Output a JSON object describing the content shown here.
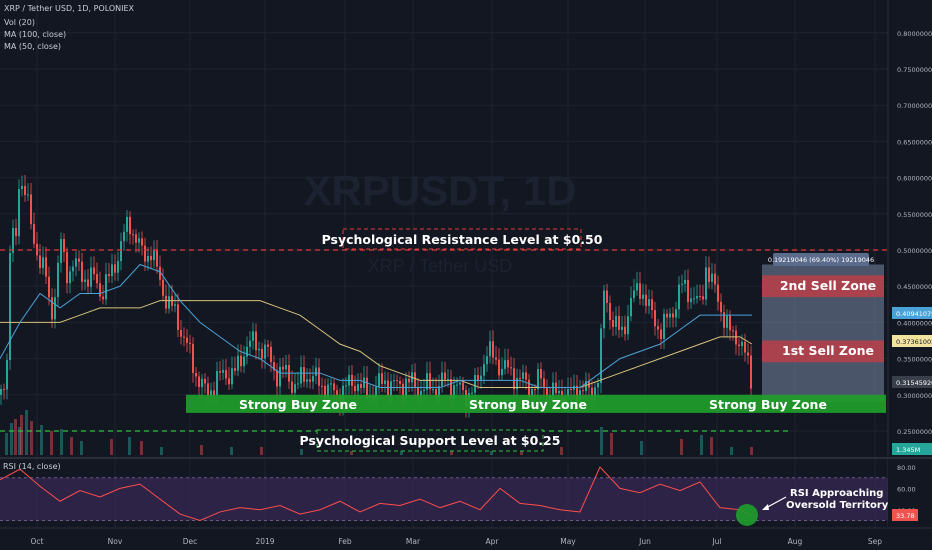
{
  "header": {
    "symbol_line": "XRP / Tether USD, 1D, POLONIEX",
    "indicator_1": "Vol (20)",
    "indicator_2": "MA (100, close)",
    "indicator_3": "MA (50, close)",
    "rsi_label": "RSI (14, close)"
  },
  "colors": {
    "background": "#131722",
    "bull": "#26a69a",
    "bear": "#ef5350",
    "ma50": "#4aa3d8",
    "ma100": "#d6c27a",
    "rsi_line": "#ff4d4d",
    "rsi_band": "#3b2a5a",
    "buy_zone": "#1e9e2a",
    "sell_zone": "#b5404a",
    "measure_box": "#7888a6"
  },
  "chart_data": [
    {
      "type": "candlestick",
      "watermark_symbol": "XRPUSDT, 1D",
      "watermark_name": "XRP / Tether USD",
      "x_tick_labels": [
        "Oct",
        "Nov",
        "Dec",
        "2019",
        "Feb",
        "Mar",
        "Apr",
        "May",
        "Jun",
        "Jul",
        "Aug",
        "Sep"
      ],
      "y_tick_labels": [
        "0.80000000",
        "0.75000000",
        "0.70000000",
        "0.65000000",
        "0.60000000",
        "0.55000000",
        "0.50000000",
        "0.45000000",
        "0.40000000",
        "0.35000000",
        "0.30000000",
        "0.25000000"
      ],
      "ylim": [
        0.2,
        0.83
      ],
      "price_labels": {
        "ma50_value": "0.40941079",
        "ma100_value": "0.37361003",
        "last_price": "0.31545920",
        "volume": "1.345M"
      },
      "measure_label": "0.19219046 (69.40%) 19219046",
      "annotations": {
        "resistance": "Psychological Resistance Level at $0.50",
        "support": "Psychological Support Level at $0.25",
        "buy_zone": "Strong Buy Zone",
        "sell_zone_1": "1st Sell Zone",
        "sell_zone_2": "2nd Sell Zone"
      },
      "levels": {
        "resistance": 0.5,
        "support": 0.25,
        "buy_zone": [
          0.275,
          0.3
        ],
        "sell_zone_1": [
          0.345,
          0.375
        ],
        "sell_zone_2": [
          0.435,
          0.465
        ],
        "measure_box": [
          0.29,
          0.48
        ]
      },
      "price_path": {
        "x": [
          0,
          7,
          10,
          14,
          18,
          25,
          30,
          38,
          45,
          50,
          56,
          60,
          65,
          73,
          80,
          86,
          95,
          100,
          108,
          116,
          128,
          134,
          142,
          150,
          158,
          166,
          175,
          185,
          195,
          205,
          215,
          225,
          235,
          245,
          255,
          265,
          275,
          285,
          295,
          305,
          315,
          325,
          335,
          345,
          355,
          365,
          375,
          385,
          395,
          405,
          415,
          425,
          435,
          445,
          455,
          465,
          475,
          485,
          493,
          500,
          510,
          520,
          530,
          540,
          550,
          560,
          570,
          580,
          590,
          598,
          603,
          610,
          620,
          630,
          640,
          650,
          660,
          670,
          680,
          690,
          700,
          705,
          712,
          720,
          730,
          738,
          745,
          752
        ],
        "close": [
          0.3,
          0.36,
          0.56,
          0.48,
          0.6,
          0.58,
          0.53,
          0.49,
          0.46,
          0.41,
          0.46,
          0.51,
          0.47,
          0.48,
          0.47,
          0.46,
          0.46,
          0.44,
          0.46,
          0.49,
          0.54,
          0.52,
          0.49,
          0.5,
          0.46,
          0.43,
          0.41,
          0.37,
          0.33,
          0.3,
          0.32,
          0.33,
          0.33,
          0.37,
          0.37,
          0.36,
          0.33,
          0.33,
          0.31,
          0.33,
          0.32,
          0.31,
          0.3,
          0.31,
          0.32,
          0.3,
          0.31,
          0.32,
          0.31,
          0.32,
          0.31,
          0.31,
          0.31,
          0.32,
          0.31,
          0.3,
          0.31,
          0.36,
          0.35,
          0.34,
          0.33,
          0.32,
          0.31,
          0.32,
          0.3,
          0.3,
          0.3,
          0.31,
          0.3,
          0.33,
          0.44,
          0.41,
          0.38,
          0.43,
          0.45,
          0.41,
          0.39,
          0.41,
          0.45,
          0.44,
          0.42,
          0.48,
          0.45,
          0.42,
          0.38,
          0.38,
          0.35,
          0.31
        ]
      },
      "ma50": {
        "x": [
          0,
          20,
          40,
          60,
          80,
          100,
          120,
          140,
          160,
          180,
          200,
          220,
          240,
          260,
          280,
          300,
          320,
          340,
          360,
          380,
          400,
          420,
          440,
          460,
          480,
          500,
          520,
          540,
          560,
          580,
          600,
          620,
          640,
          660,
          680,
          700,
          720,
          740,
          752
        ],
        "value": [
          0.35,
          0.4,
          0.44,
          0.42,
          0.44,
          0.44,
          0.45,
          0.48,
          0.47,
          0.43,
          0.4,
          0.38,
          0.36,
          0.35,
          0.33,
          0.33,
          0.33,
          0.32,
          0.32,
          0.31,
          0.31,
          0.31,
          0.31,
          0.32,
          0.32,
          0.32,
          0.32,
          0.31,
          0.31,
          0.31,
          0.33,
          0.35,
          0.36,
          0.37,
          0.39,
          0.41,
          0.41,
          0.41,
          0.41
        ]
      },
      "ma100": {
        "x": [
          0,
          20,
          40,
          60,
          80,
          100,
          120,
          140,
          160,
          180,
          200,
          220,
          240,
          260,
          280,
          300,
          320,
          340,
          360,
          380,
          400,
          420,
          440,
          460,
          480,
          500,
          520,
          540,
          560,
          580,
          600,
          620,
          640,
          660,
          680,
          700,
          720,
          740,
          752
        ],
        "value": [
          0.4,
          0.4,
          0.4,
          0.4,
          0.41,
          0.42,
          0.42,
          0.42,
          0.43,
          0.43,
          0.43,
          0.43,
          0.43,
          0.43,
          0.42,
          0.41,
          0.39,
          0.37,
          0.36,
          0.34,
          0.33,
          0.32,
          0.32,
          0.32,
          0.31,
          0.31,
          0.31,
          0.31,
          0.31,
          0.31,
          0.32,
          0.33,
          0.34,
          0.35,
          0.36,
          0.37,
          0.38,
          0.38,
          0.37
        ]
      },
      "volume": {
        "bull": [
          [
            5,
            22
          ],
          [
            10,
            32
          ],
          [
            18,
            28
          ],
          [
            25,
            45
          ],
          [
            40,
            30
          ],
          [
            60,
            26
          ],
          [
            80,
            14
          ],
          [
            128,
            18
          ],
          [
            160,
            8
          ],
          [
            230,
            8
          ],
          [
            300,
            6
          ],
          [
            400,
            6
          ],
          [
            490,
            15
          ],
          [
            600,
            28
          ],
          [
            640,
            14
          ],
          [
            700,
            20
          ],
          [
            730,
            8
          ]
        ],
        "bear": [
          [
            14,
            36
          ],
          [
            20,
            40
          ],
          [
            30,
            34
          ],
          [
            50,
            24
          ],
          [
            70,
            18
          ],
          [
            110,
            16
          ],
          [
            140,
            14
          ],
          [
            200,
            10
          ],
          [
            260,
            8
          ],
          [
            350,
            6
          ],
          [
            450,
            6
          ],
          [
            520,
            10
          ],
          [
            560,
            8
          ],
          [
            610,
            22
          ],
          [
            680,
            16
          ],
          [
            710,
            18
          ],
          [
            750,
            8
          ]
        ]
      }
    },
    {
      "type": "line",
      "name": "RSI (14, close)",
      "y_tick_labels": [
        "80.00",
        "60.00",
        "40.00",
        "20.00"
      ],
      "ylim": [
        12,
        85
      ],
      "band": [
        30,
        70
      ],
      "current_value": "33.78",
      "annotation": "RSI Approaching Oversold Territory",
      "x": [
        0,
        20,
        40,
        60,
        80,
        100,
        120,
        140,
        160,
        180,
        200,
        220,
        240,
        260,
        280,
        300,
        320,
        340,
        360,
        380,
        400,
        420,
        440,
        460,
        480,
        500,
        520,
        540,
        560,
        580,
        600,
        620,
        640,
        660,
        680,
        700,
        720,
        740,
        752
      ],
      "values": [
        68,
        78,
        62,
        48,
        58,
        52,
        60,
        64,
        50,
        36,
        30,
        38,
        42,
        40,
        44,
        36,
        40,
        48,
        38,
        46,
        44,
        50,
        42,
        48,
        40,
        60,
        46,
        44,
        40,
        38,
        80,
        60,
        56,
        64,
        58,
        66,
        42,
        40,
        34
      ]
    }
  ]
}
